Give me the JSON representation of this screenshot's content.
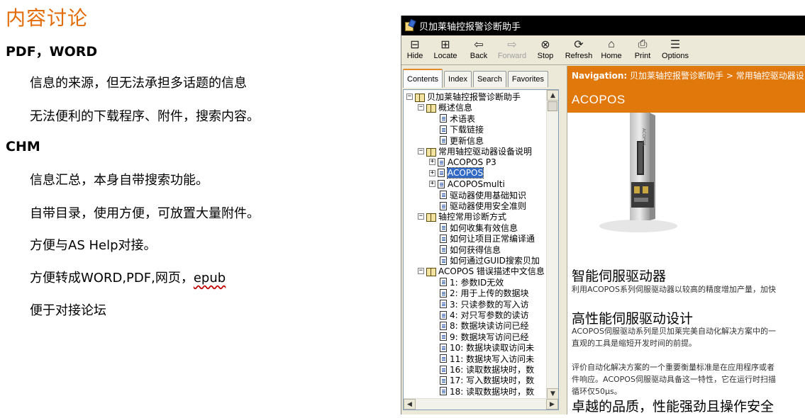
{
  "slide": {
    "title": "内容讨论",
    "sections": [
      {
        "heading": "PDF，WORD",
        "bullets": [
          "信息的来源，但无法承担多话题的信息",
          "无法便利的下载程序、附件，搜索内容。"
        ]
      },
      {
        "heading": "CHM",
        "bullets": [
          "信息汇总，本身自带搜索功能。",
          "自带目录，使用方便，可放置大量附件。",
          "方便与AS Help对接。"
        ]
      }
    ],
    "bullet_epub_prefix": "方便转成WORD,PDF,网页，",
    "bullet_epub_word": "epub",
    "bullet_last": "便于对接论坛"
  },
  "window": {
    "title": "贝加莱轴控报警诊断助手",
    "toolbar": [
      {
        "label": "Hide",
        "icon": "hide-icon",
        "glyph": "⊟"
      },
      {
        "label": "Locate",
        "icon": "locate-icon",
        "glyph": "⊞"
      },
      {
        "label": "Back",
        "icon": "back-arrow-icon",
        "glyph": "⇦"
      },
      {
        "label": "Forward",
        "icon": "forward-arrow-icon",
        "glyph": "⇨"
      },
      {
        "label": "Stop",
        "icon": "stop-icon",
        "glyph": "⊗"
      },
      {
        "label": "Refresh",
        "icon": "refresh-icon",
        "glyph": "⟳"
      },
      {
        "label": "Home",
        "icon": "home-icon",
        "glyph": "⌂"
      },
      {
        "label": "Print",
        "icon": "printer-icon",
        "glyph": "⎙"
      },
      {
        "label": "Options",
        "icon": "options-icon",
        "glyph": "☰"
      }
    ],
    "tabs": [
      "Contents",
      "Index",
      "Search",
      "Favorites"
    ],
    "tree": [
      {
        "label": "贝加莱轴控报警诊断助手",
        "type": "book",
        "level": 0,
        "exp": "−"
      },
      {
        "label": "概述信息",
        "type": "book",
        "level": 1,
        "exp": "−"
      },
      {
        "label": "术语表",
        "type": "page",
        "level": 2
      },
      {
        "label": "下载链接",
        "type": "page",
        "level": 2
      },
      {
        "label": "更新信息",
        "type": "page",
        "level": 2
      },
      {
        "label": "常用轴控驱动器设备说明",
        "type": "book",
        "level": 1,
        "exp": "−"
      },
      {
        "label": "ACOPOS P3",
        "type": "page",
        "level": 2,
        "exp": "+"
      },
      {
        "label": "ACOPOS",
        "type": "page",
        "level": 2,
        "exp": "+",
        "selected": true
      },
      {
        "label": "ACOPOSmulti",
        "type": "page",
        "level": 2,
        "exp": "+"
      },
      {
        "label": "驱动器使用基础知识",
        "type": "page",
        "level": 2
      },
      {
        "label": "驱动器使用安全准则",
        "type": "page",
        "level": 2
      },
      {
        "label": "轴控常用诊断方式",
        "type": "book",
        "level": 1,
        "exp": "−"
      },
      {
        "label": "如何收集有效信息",
        "type": "page",
        "level": 2
      },
      {
        "label": "如何让项目正常编译通",
        "type": "page",
        "level": 2
      },
      {
        "label": "如何获得信息",
        "type": "page",
        "level": 2
      },
      {
        "label": "如何通过GUID搜索贝加",
        "type": "page",
        "level": 2
      },
      {
        "label": "ACOPOS 错误描述中文信息",
        "type": "book",
        "level": 1,
        "exp": "−"
      },
      {
        "label": "1: 参数ID无效",
        "type": "page",
        "level": 2
      },
      {
        "label": "2: 用于上传的数据块",
        "type": "page",
        "level": 2
      },
      {
        "label": "3: 只读参数的写入访",
        "type": "page",
        "level": 2
      },
      {
        "label": "4: 对只写参数的读访",
        "type": "page",
        "level": 2
      },
      {
        "label": "8: 数据块读访问已经",
        "type": "page",
        "level": 2
      },
      {
        "label": "9: 数据块写访问已经",
        "type": "page",
        "level": 2
      },
      {
        "label": "10: 数据块读取访问未",
        "type": "page",
        "level": 2
      },
      {
        "label": "11: 数据块写入访问未",
        "type": "page",
        "level": 2
      },
      {
        "label": "16: 读取数据块时，数",
        "type": "page",
        "level": 2
      },
      {
        "label": "17: 写入数据块时，数",
        "type": "page",
        "level": 2
      },
      {
        "label": "18: 读取数据块时，数",
        "type": "page",
        "level": 2
      }
    ],
    "content": {
      "navigation_label": "Navigation:",
      "navigation_path": "贝加莱轴控报警诊断助手 > 常用轴控驱动器设",
      "page_title": "ACOPOS",
      "h1": "智能伺服驱动器",
      "p1": "利用ACOPOS系列伺服驱动器以较高的精度增加产量，加快",
      "h2": "高性能伺服驱动设计",
      "p2a": "ACOPOS伺服驱动系列是贝加莱完美自动化解决方案中的一",
      "p2b": "直观的工具是缩短开发时间的前提。",
      "p3a": "评价自动化解决方案的一个重要衡量标准是在应用程序或者",
      "p3b": "件响应。ACOPOS伺服驱动具备这一特性，它在运行时扫描",
      "p3c": "循环仅50μs。",
      "h3": "卓越的品质，性能强劲且操作安全"
    }
  },
  "colors": {
    "slide_title": "#e36c0a",
    "nav_bar": "#e1780c",
    "selection": "#316ac5"
  }
}
